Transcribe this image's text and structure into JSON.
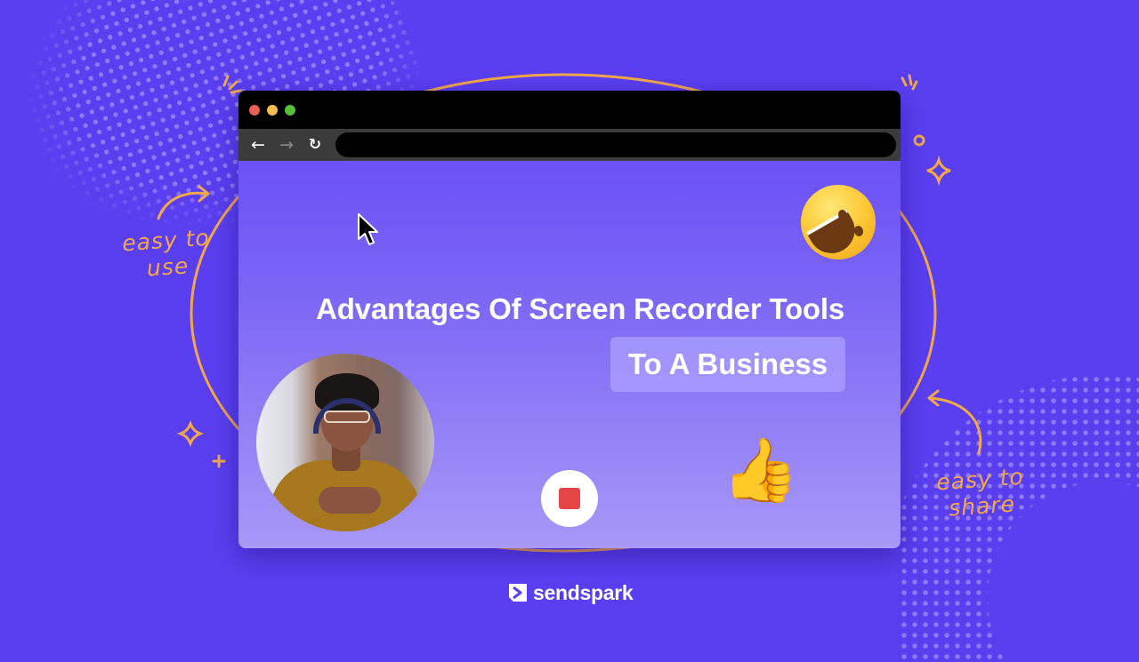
{
  "colors": {
    "background": "#5a3ff0",
    "accent_orange": "#f2a84a",
    "record_red": "#e64545",
    "traffic_red": "#ec5f57",
    "traffic_yellow": "#f5bd4f",
    "traffic_green": "#57c038"
  },
  "browser": {
    "window_controls": [
      "close",
      "minimize",
      "maximize"
    ],
    "toolbar": {
      "back_icon": "←",
      "forward_icon": "→",
      "reload_icon": "↻",
      "url_value": ""
    },
    "content": {
      "headline": "Advantages Of Screen Recorder Tools",
      "headline_highlight": "To A Business",
      "emoji_top": "grinning-face",
      "emoji_bottom": "👍",
      "record_button": "stop-recording"
    }
  },
  "annotations": {
    "left_label_line1": "easy to",
    "left_label_line2": "use",
    "right_label_line1": "easy to",
    "right_label_line2": "share"
  },
  "brand": {
    "name": "sendspark"
  }
}
